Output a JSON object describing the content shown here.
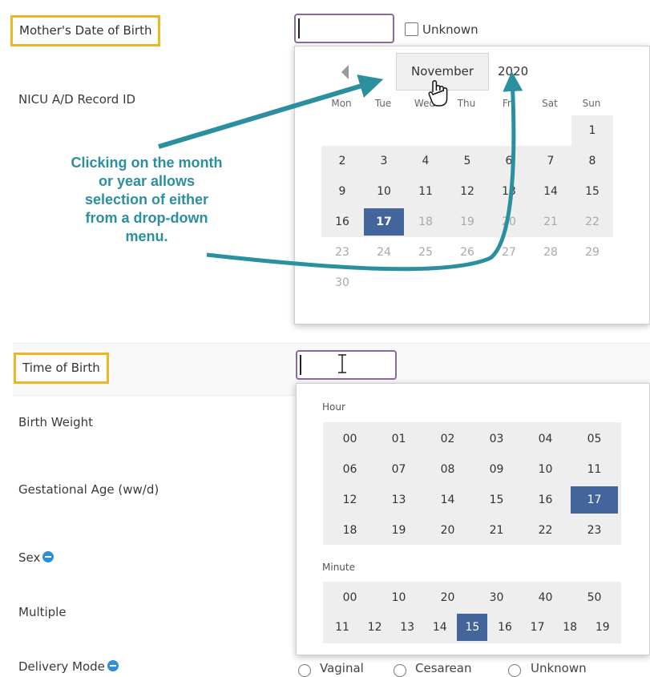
{
  "form": {
    "mother_dob_label": "Mother's Date of Birth",
    "unknown_label": "Unknown",
    "nicu_label": "NICU A/D Record ID",
    "time_of_birth_label": "Time of Birth",
    "birth_weight_label": "Birth Weight",
    "gestational_age_label": "Gestational Age (ww/d)",
    "sex_label": "Sex",
    "multiple_label": "Multiple",
    "delivery_mode_label": "Delivery Mode",
    "delivery_options": [
      "Vaginal",
      "Cesarean",
      "Unknown"
    ]
  },
  "calendar": {
    "prev_icon": "chevron-left-icon",
    "month": "November",
    "year": "2020",
    "weekdays": [
      "Mon",
      "Tue",
      "Wed",
      "Thu",
      "Fri",
      "Sat",
      "Sun"
    ],
    "selected_day": "17",
    "weeks": [
      [
        "",
        "",
        "",
        "",
        "",
        "",
        "1"
      ],
      [
        "2",
        "3",
        "4",
        "5",
        "6",
        "7",
        "8"
      ],
      [
        "9",
        "10",
        "11",
        "12",
        "13",
        "14",
        "15"
      ],
      [
        "16",
        "17",
        "18",
        "19",
        "20",
        "21",
        "22"
      ],
      [
        "23",
        "24",
        "25",
        "26",
        "27",
        "28",
        "29"
      ],
      [
        "30",
        "",
        "",
        "",
        "",
        "",
        ""
      ]
    ],
    "muted_from_day": 18
  },
  "time_picker": {
    "hour_label": "Hour",
    "minute_label": "Minute",
    "hours": [
      "00",
      "01",
      "02",
      "03",
      "04",
      "05",
      "06",
      "07",
      "08",
      "09",
      "10",
      "11",
      "12",
      "13",
      "14",
      "15",
      "16",
      "17",
      "18",
      "19",
      "20",
      "21",
      "22",
      "23"
    ],
    "selected_hour": "17",
    "minutes_row1": [
      "00",
      "10",
      "20",
      "30",
      "40",
      "50"
    ],
    "minutes_row2": [
      "11",
      "12",
      "13",
      "14",
      "15",
      "16",
      "17",
      "18",
      "19"
    ],
    "selected_minute": "15"
  },
  "annotation": {
    "text_lines": [
      "Clicking on the month",
      "or year allows",
      "selection of either",
      "from a drop-down",
      "menu."
    ],
    "color": "#2b8fa0"
  },
  "colors": {
    "highlight": "#f0b522",
    "selected": "#44659b",
    "input_border": "#8c6aa0",
    "info_icon": "#2e8fd1"
  }
}
